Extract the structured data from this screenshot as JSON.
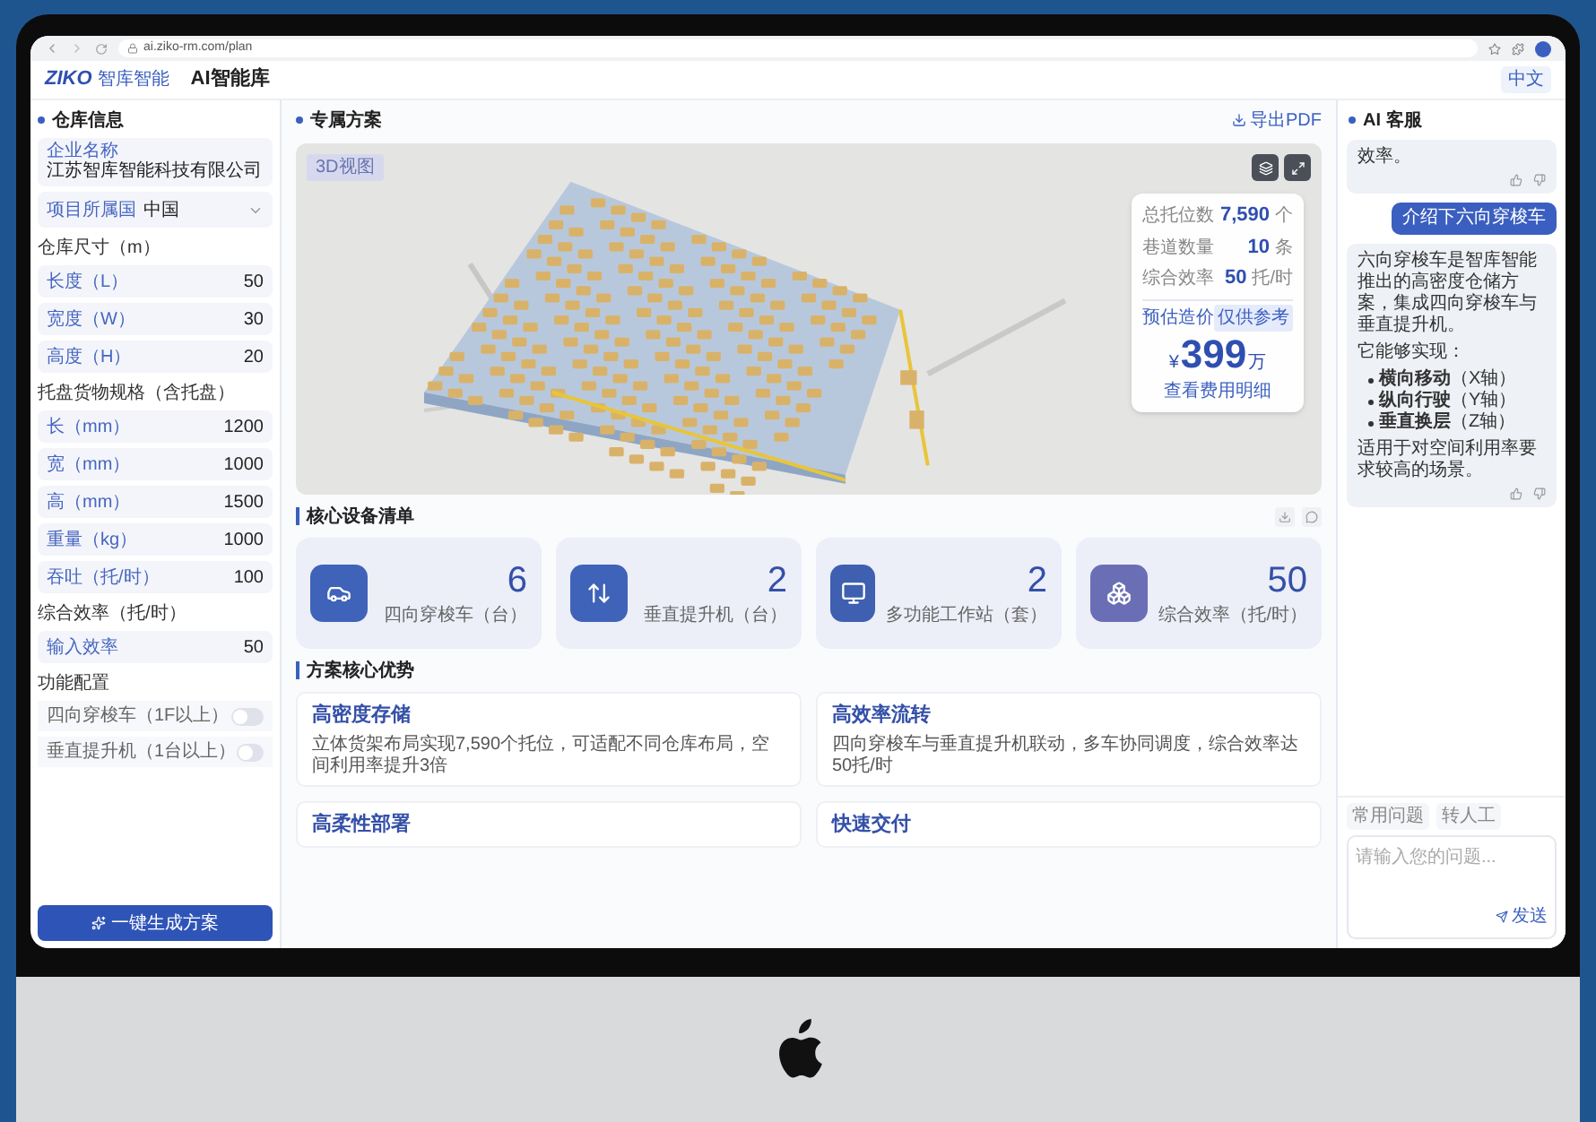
{
  "browser": {
    "url": "ai.ziko-rm.com/plan"
  },
  "header": {
    "logo": "ZIKO",
    "brand": "智库智能",
    "title": "AI智能库",
    "language": "中文"
  },
  "left_panel": {
    "title": "仓库信息",
    "items": [
      {
        "kind": "text",
        "label": "企业名称",
        "value": "江苏智库智能科技有限公司"
      },
      {
        "kind": "select",
        "label": "项目所属国",
        "value": "中国"
      },
      {
        "kind": "section",
        "label": "仓库尺寸（m）"
      },
      {
        "kind": "number",
        "label": "长度（L）",
        "value": "50"
      },
      {
        "kind": "number",
        "label": "宽度（W）",
        "value": "30"
      },
      {
        "kind": "number",
        "label": "高度（H）",
        "value": "20"
      },
      {
        "kind": "section",
        "label": "托盘货物规格（含托盘）"
      },
      {
        "kind": "number",
        "label": "长（mm）",
        "value": "1200"
      },
      {
        "kind": "number",
        "label": "宽（mm）",
        "value": "1000"
      },
      {
        "kind": "number",
        "label": "高（mm）",
        "value": "1500"
      },
      {
        "kind": "number",
        "label": "重量（kg）",
        "value": "1000"
      },
      {
        "kind": "number",
        "label": "吞吐（托/时）",
        "value": "100"
      },
      {
        "kind": "section",
        "label": "综合效率（托/时）"
      },
      {
        "kind": "number",
        "label": "输入效率",
        "value": "50"
      },
      {
        "kind": "section",
        "label": "功能配置"
      },
      {
        "kind": "toggle",
        "label": "四向穿梭车（1F以上）",
        "on": false
      },
      {
        "kind": "toggle",
        "label": "垂直提升机（1台以上）",
        "on": false
      }
    ],
    "button": "一键生成方案"
  },
  "plan": {
    "title": "专属方案",
    "export": "导出PDF",
    "view_label": "3D视图",
    "stats": [
      {
        "label": "总托位数",
        "value": "7,590",
        "unit": "个"
      },
      {
        "label": "巷道数量",
        "value": "10",
        "unit": "条"
      },
      {
        "label": "综合效率",
        "value": "50",
        "unit": "托/时"
      }
    ],
    "estimate": {
      "label": "预估造价",
      "badge": "仅供参考",
      "currency": "¥",
      "value": "399",
      "unit": "万",
      "note": "查看费用明细"
    }
  },
  "equipment": {
    "title": "核心设备清单",
    "cards": [
      {
        "kind": "shuttle",
        "value": "6",
        "label": "四向穿梭车（台）"
      },
      {
        "kind": "lift",
        "value": "2",
        "label": "垂直提升机（台）"
      },
      {
        "kind": "station",
        "value": "2",
        "label": "多功能工作站（套）"
      },
      {
        "kind": "efficiency",
        "value": "50",
        "label": "综合效率（托/时）"
      }
    ]
  },
  "advantages": {
    "title": "方案核心优势",
    "items": [
      {
        "title": "高密度存储",
        "text": "立体货架布局实现7,590个托位，可适配不同仓库布局，空间利用率提升3倍"
      },
      {
        "title": "高效率流转",
        "text": "四向穿梭车与垂直提升机联动，多车协同调度，综合效率达50托/时"
      },
      {
        "title": "高柔性部署"
      },
      {
        "title": "快速交付"
      }
    ]
  },
  "chat": {
    "title": "AI 客服",
    "messages": [
      {
        "kind": "assistant",
        "paragraphs": [
          {
            "kind": "text",
            "text": "效率。"
          }
        ]
      },
      {
        "kind": "user",
        "paragraphs": [
          {
            "kind": "text",
            "text": "介绍下六向穿梭车"
          }
        ]
      },
      {
        "kind": "assistant",
        "paragraphs": [
          {
            "kind": "text",
            "text": "六向穿梭车是智库智能推出的高密度仓储方案，集成四向穿梭车与垂直提升机。"
          },
          {
            "kind": "text",
            "text": "它能够实现："
          },
          {
            "kind": "list",
            "items": [
              "**横向移动**（X轴）",
              "**纵向行驶**（Y轴）",
              "**垂直换层**（Z轴）"
            ]
          },
          {
            "kind": "text",
            "text": "适用于对空间利用率要求较高的场景。"
          }
        ]
      }
    ],
    "quick": [
      "常用问题",
      "转人工"
    ],
    "placeholder": "请输入您的问题...",
    "send": "发送"
  }
}
